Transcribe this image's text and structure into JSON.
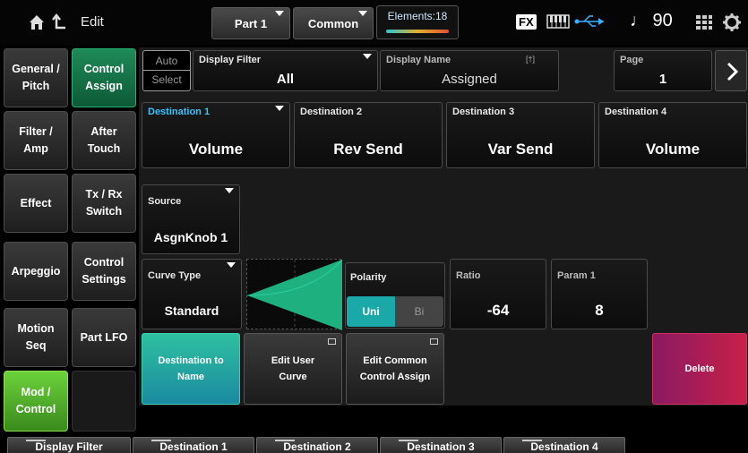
{
  "topbar": {
    "title": "Edit",
    "part_label": "Part 1",
    "common_label": "Common",
    "elements_label": "Elements:18",
    "fx_label": "FX",
    "tempo": "♩ 90"
  },
  "left_tabs": {
    "col1": [
      {
        "label": "General / Pitch"
      },
      {
        "label": "Filter / Amp"
      },
      {
        "label": "Effect"
      },
      {
        "label": "Arpeggio"
      },
      {
        "label": "Motion Seq"
      },
      {
        "label": "Mod / Control"
      }
    ],
    "col2": [
      {
        "label": "Control Assign"
      },
      {
        "label": "After Touch"
      },
      {
        "label": "Tx / Rx Switch"
      },
      {
        "label": "Control Settings"
      },
      {
        "label": "Part LFO"
      }
    ]
  },
  "header": {
    "auto_select_top": "Auto",
    "auto_select_bottom": "Select",
    "display_filter": {
      "label": "Display Filter",
      "value": "All"
    },
    "display_name": {
      "label": "Display Name",
      "tag": "[†]",
      "value": "Assigned"
    },
    "page": {
      "label": "Page",
      "value": "1"
    }
  },
  "destinations": [
    {
      "label": "Destination 1",
      "value": "Volume"
    },
    {
      "label": "Destination 2",
      "value": "Rev Send"
    },
    {
      "label": "Destination 3",
      "value": "Var Send"
    },
    {
      "label": "Destination 4",
      "value": "Volume"
    }
  ],
  "source": {
    "label": "Source",
    "value": "AsgnKnob 1"
  },
  "curve_type": {
    "label": "Curve Type",
    "value": "Standard"
  },
  "polarity": {
    "label": "Polarity",
    "uni": "Uni",
    "bi": "Bi"
  },
  "ratio": {
    "label": "Ratio",
    "value": "-64"
  },
  "param1": {
    "label": "Param 1",
    "value": "8"
  },
  "actions": {
    "dest_to_name": "Destination to Name",
    "edit_user_curve": "Edit User Curve",
    "edit_common": "Edit Common Control Assign",
    "delete": "Delete"
  },
  "bottom_tabs": [
    "Display Filter",
    "Destination 1",
    "Destination 2",
    "Destination 3",
    "Destination 4"
  ],
  "colors": {
    "accent_teal": "#1aa8a8",
    "active_tab": "#1f8a58",
    "delete": "#c8204a",
    "selected_label": "#34c5ff"
  }
}
